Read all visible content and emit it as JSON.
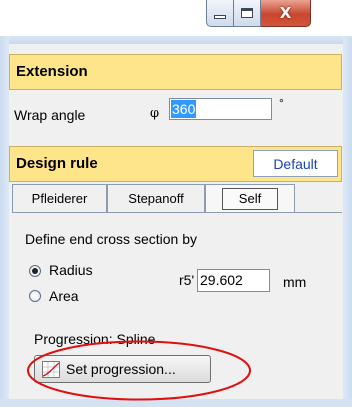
{
  "window": {
    "controls": {
      "minimize_icon": "minimize-icon",
      "maximize_icon": "maximize-icon",
      "close_glyph": "X"
    }
  },
  "extension": {
    "header": "Extension",
    "wrap_angle_label": "Wrap angle",
    "phi_symbol": "φ",
    "wrap_angle_value": "360",
    "unit": "°"
  },
  "design_rule": {
    "header": "Design rule",
    "default_button": "Default",
    "tabs": [
      {
        "label": "Pfleiderer",
        "active": false
      },
      {
        "label": "Stepanoff",
        "active": false
      },
      {
        "label": "Self",
        "active": true
      }
    ],
    "define_label": "Define end cross section by",
    "options": [
      {
        "label": "Radius",
        "checked": true
      },
      {
        "label": "Area",
        "checked": false
      }
    ],
    "r5_label": "r5'",
    "r5_value": "29.602",
    "r5_unit": "mm",
    "progression_label": "Progression: Spline",
    "set_progression_button": "Set progression...",
    "highlight_color": "#e01010"
  }
}
